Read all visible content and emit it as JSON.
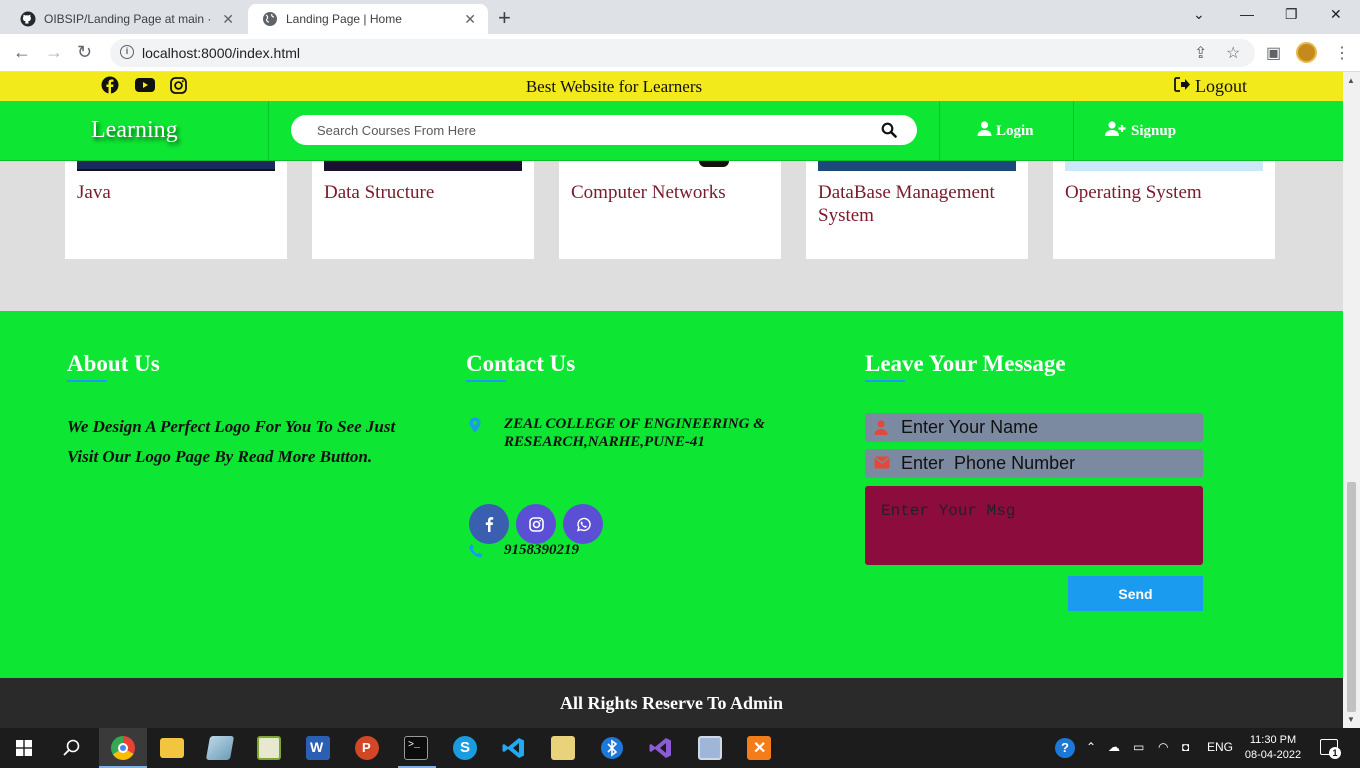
{
  "browser": {
    "tabs": [
      {
        "title": "OIBSIP/Landing Page at main · Al",
        "icon": "github-icon"
      },
      {
        "title": "Landing Page | Home",
        "icon": "globe-icon"
      }
    ],
    "url": "localhost:8000/index.html"
  },
  "topbar": {
    "tagline": "Best Website for Learners",
    "logout_label": "Logout"
  },
  "navbar": {
    "brand": "Learning",
    "search_placeholder": "Search Courses From Here",
    "login_label": "Login",
    "signup_label": "Signup"
  },
  "courses": [
    {
      "title": "Java",
      "image_color": "#1a2a5a"
    },
    {
      "title": "Data Structure",
      "image_color": "#1a1030"
    },
    {
      "title": "Computer Networks",
      "image_color": "#ffffff"
    },
    {
      "title": "DataBase Management System",
      "image_color": "#1a4a7a"
    },
    {
      "title": "Operating System",
      "image_color": "#cde8f8"
    }
  ],
  "footer": {
    "about": {
      "heading": "About Us",
      "text": "We Design A Perfect Logo For You To See Just Visit Our Logo Page By Read More Button."
    },
    "contact": {
      "heading": "Contact Us",
      "address": "ZEAL COLLEGE OF ENGINEERING & RESEARCH,NARHE,PUNE-41",
      "phone": "9158390219"
    },
    "message": {
      "heading": "Leave Your Message",
      "name_placeholder": "Enter Your Name",
      "phone_placeholder": "Enter  Phone Number",
      "msg_placeholder": "Enter Your Msg",
      "send_label": "Send"
    },
    "copyright": "All Rights Reserve To Admin"
  },
  "taskbar": {
    "lang": "ENG",
    "time": "11:30 PM",
    "date": "08-04-2022",
    "notifications": "1"
  },
  "colors": {
    "accent_green": "#0ee634",
    "top_yellow": "#f2ea1a",
    "accent_blue": "#1a9bf0",
    "msg_maroon": "#8d0c3e"
  }
}
